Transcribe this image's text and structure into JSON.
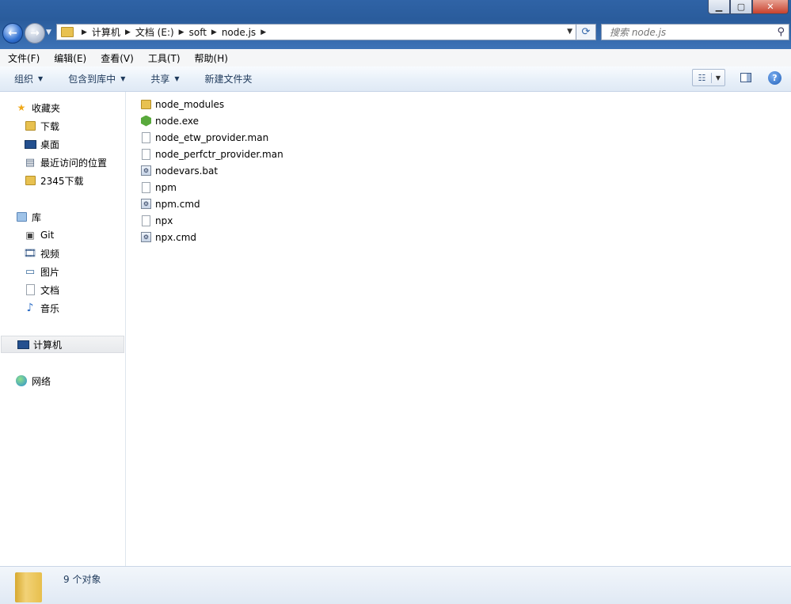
{
  "address": {
    "crumbs": [
      "计算机",
      "文档 (E:)",
      "soft",
      "node.js"
    ]
  },
  "search": {
    "placeholder": "搜索 node.js"
  },
  "menu": [
    "文件(F)",
    "编辑(E)",
    "查看(V)",
    "工具(T)",
    "帮助(H)"
  ],
  "toolbar": {
    "organize": "组织",
    "include_in_library": "包含到库中",
    "share": "共享",
    "new_folder": "新建文件夹"
  },
  "nav": {
    "favorites": "收藏夹",
    "favorites_items": [
      "下载",
      "桌面",
      "最近访问的位置",
      "2345下载"
    ],
    "libraries": "库",
    "library_items": [
      "Git",
      "视频",
      "图片",
      "文档",
      "音乐"
    ],
    "computer": "计算机",
    "network": "网络"
  },
  "files": [
    {
      "name": "node_modules",
      "icon": "folder-icon"
    },
    {
      "name": "node.exe",
      "icon": "node-exe-icon"
    },
    {
      "name": "node_etw_provider.man",
      "icon": "file-icon"
    },
    {
      "name": "node_perfctr_provider.man",
      "icon": "file-icon"
    },
    {
      "name": "nodevars.bat",
      "icon": "batch-file-icon"
    },
    {
      "name": "npm",
      "icon": "file-icon"
    },
    {
      "name": "npm.cmd",
      "icon": "batch-file-icon"
    },
    {
      "name": "npx",
      "icon": "file-icon"
    },
    {
      "name": "npx.cmd",
      "icon": "batch-file-icon"
    }
  ],
  "status": {
    "count_text": "9 个对象"
  },
  "colors": {
    "titlebar": "#2f63a6",
    "command_bar": "#e8f0f9",
    "folder": "#e8c150"
  }
}
